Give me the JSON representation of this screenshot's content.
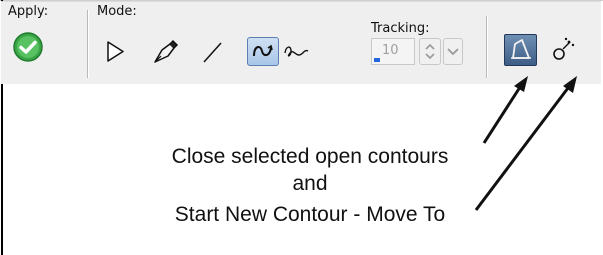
{
  "toolbar": {
    "apply_label": "Apply:",
    "mode_label": "Mode:",
    "tracking_label": "Tracking:",
    "tracking_value": "10",
    "icons": [
      "checkmark-icon",
      "arrow-pointer-icon",
      "pen-icon",
      "line-icon",
      "curve-icon",
      "freehand-curve-icon",
      "close-contour-icon",
      "new-contour-icon"
    ]
  },
  "annotation": {
    "line1": "Close selected open contours",
    "line2": "and",
    "line3": "Start New Contour - Move To"
  },
  "colors": {
    "apply_green": "#3aa446",
    "pressed_blue": "#a9c6e8",
    "dark_button": "#3d5d86",
    "tracking_indicator": "#2266dd"
  }
}
